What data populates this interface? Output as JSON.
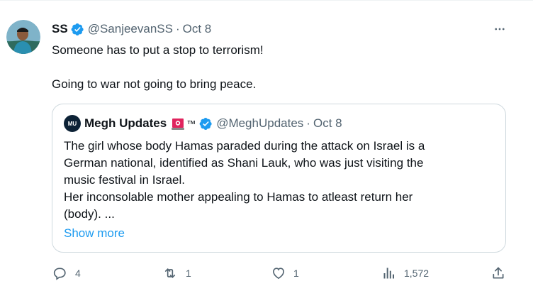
{
  "tweet": {
    "author": {
      "name": "SS",
      "handle": "@SanjeevanSS",
      "time": "Oct 8"
    },
    "separator": "·",
    "text_lines": [
      "Someone has to put a stop to terrorism!",
      "Going to war not going to bring peace."
    ],
    "quote": {
      "author": {
        "name": "Megh Updates",
        "emoji_icon": "siren-icon",
        "tm": "™",
        "handle": "@MeghUpdates",
        "time": "Oct 8",
        "avatar_text": "MU"
      },
      "text_lines": [
        "The girl whose body Hamas paraded during the attack on Israel is a",
        "German national, identified as Shani Lauk, who was just visiting the",
        "music festival in Israel.",
        "Her inconsolable mother appealing to Hamas to atleast return her",
        "(body). ..."
      ],
      "show_more": "Show more"
    },
    "actions": {
      "replies": "4",
      "reposts": "1",
      "likes": "1",
      "views": "1,572"
    }
  },
  "colors": {
    "accent": "#1d9bf0",
    "text": "#0f1419",
    "muted": "#536471",
    "border": "#cfd9de"
  }
}
